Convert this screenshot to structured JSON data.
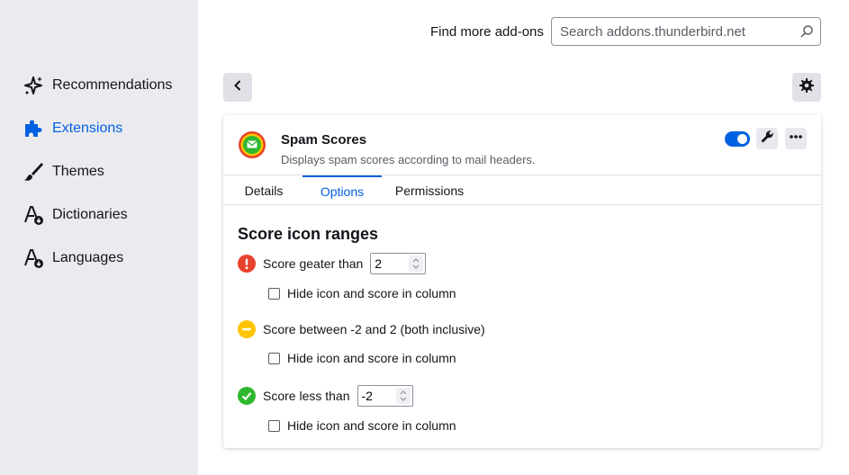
{
  "sidebar": {
    "items": [
      {
        "label": "Recommendations",
        "icon": "sparkle-icon"
      },
      {
        "label": "Extensions",
        "icon": "puzzle-icon",
        "active": true
      },
      {
        "label": "Themes",
        "icon": "brush-icon"
      },
      {
        "label": "Dictionaries",
        "icon": "dictionary-icon"
      },
      {
        "label": "Languages",
        "icon": "language-icon"
      }
    ]
  },
  "header": {
    "find_label": "Find more add-ons",
    "search_placeholder": "Search addons.thunderbird.net"
  },
  "addon": {
    "name": "Spam Scores",
    "description": "Displays spam scores according to mail headers.",
    "enabled": true
  },
  "tabs": [
    "Details",
    "Options",
    "Permissions"
  ],
  "active_tab": "Options",
  "options": {
    "title": "Score icon ranges",
    "high": {
      "label": "Score geater than",
      "value": "2",
      "hide_label": "Hide icon and score in column",
      "hide_checked": false
    },
    "mid": {
      "label": "Score between -2 and 2 (both inclusive)",
      "hide_label": "Hide icon and score in column",
      "hide_checked": false
    },
    "low": {
      "label": "Score less than",
      "value": "-2",
      "hide_label": "Hide icon and score in column",
      "hide_checked": false
    }
  },
  "colors": {
    "accent": "#0061e0",
    "danger": "#e22850",
    "warning": "#ffbd00",
    "success": "#2ac3a2"
  }
}
